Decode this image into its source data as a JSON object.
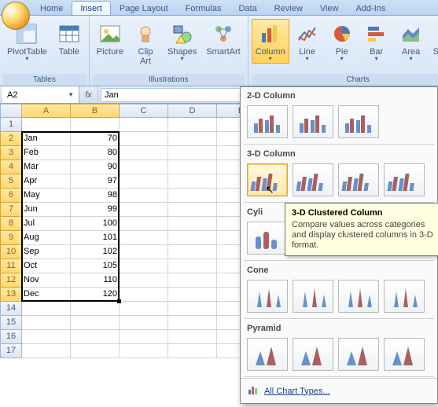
{
  "tabs": {
    "items": [
      "Home",
      "Insert",
      "Page Layout",
      "Formulas",
      "Data",
      "Review",
      "View",
      "Add-Ins"
    ],
    "active": 1
  },
  "ribbon": {
    "groups": [
      {
        "label": "Tables",
        "buttons": [
          {
            "label": "PivotTable",
            "dd": true
          },
          {
            "label": "Table"
          }
        ]
      },
      {
        "label": "Illustrations",
        "buttons": [
          {
            "label": "Picture"
          },
          {
            "label": "Clip\nArt"
          },
          {
            "label": "Shapes",
            "dd": true
          },
          {
            "label": "SmartArt"
          }
        ]
      },
      {
        "label": "Charts",
        "buttons": [
          {
            "label": "Column",
            "dd": true,
            "active": true
          },
          {
            "label": "Line",
            "dd": true
          },
          {
            "label": "Pie",
            "dd": true
          },
          {
            "label": "Bar",
            "dd": true
          },
          {
            "label": "Area",
            "dd": true
          },
          {
            "label": "Scatter",
            "dd": true
          }
        ]
      }
    ]
  },
  "namebox": "A2",
  "fx_label": "fx",
  "formula": "Jan",
  "columns": [
    "A",
    "B",
    "C",
    "D",
    "E"
  ],
  "rows": [
    1,
    2,
    3,
    4,
    5,
    6,
    7,
    8,
    9,
    10,
    11,
    12,
    13,
    14,
    15,
    16,
    17
  ],
  "sel_cols": [
    0,
    1
  ],
  "sel_rows": [
    1,
    2,
    3,
    4,
    5,
    6,
    7,
    8,
    9,
    10,
    11,
    12
  ],
  "data": [
    [
      "",
      "",
      "",
      "",
      ""
    ],
    [
      "Jan",
      "70",
      "",
      "",
      ""
    ],
    [
      "Feb",
      "80",
      "",
      "",
      ""
    ],
    [
      "Mar",
      "90",
      "",
      "",
      ""
    ],
    [
      "Apr",
      "97",
      "",
      "",
      ""
    ],
    [
      "May",
      "98",
      "",
      "",
      ""
    ],
    [
      "Jun",
      "99",
      "",
      "",
      ""
    ],
    [
      "Jul",
      "100",
      "",
      "",
      ""
    ],
    [
      "Aug",
      "101",
      "",
      "",
      ""
    ],
    [
      "Sep",
      "102",
      "",
      "",
      ""
    ],
    [
      "Oct",
      "105",
      "",
      "",
      ""
    ],
    [
      "Nov",
      "110",
      "",
      "",
      ""
    ],
    [
      "Dec",
      "120",
      "",
      "",
      ""
    ],
    [
      "",
      "",
      "",
      "",
      ""
    ],
    [
      "",
      "",
      "",
      "",
      ""
    ],
    [
      "",
      "",
      "",
      "",
      ""
    ],
    [
      "",
      "",
      "",
      "",
      ""
    ]
  ],
  "chart_panel": {
    "sections": [
      {
        "label": "2-D Column",
        "count": 3
      },
      {
        "label": "3-D Column",
        "count": 4,
        "hover": 0
      },
      {
        "label": "Cylinder",
        "count": 4,
        "partial": "Cyli"
      },
      {
        "label": "Cone",
        "count": 4
      },
      {
        "label": "Pyramid",
        "count": 4
      }
    ],
    "footer": "All Chart Types..."
  },
  "tooltip": {
    "title": "3-D Clustered Column",
    "body": "Compare values across categories and display clustered columns in 3-D format."
  }
}
